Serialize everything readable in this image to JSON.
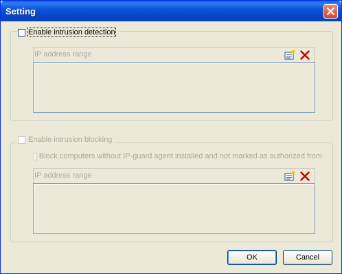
{
  "window": {
    "title": "Setting"
  },
  "detection": {
    "checkbox_label": "Enable intrusion detection",
    "checked": false,
    "list_header": "IP address range"
  },
  "blocking": {
    "checkbox_label": "Enable intrusion blocking",
    "checked": false,
    "sub_checkbox_label": "Block computers without IP-guard agent installed and not marked as authorized from",
    "list_header": "IP address range"
  },
  "buttons": {
    "ok": "OK",
    "cancel": "Cancel"
  },
  "icons": {
    "close": "close-icon",
    "add": "add-range-icon",
    "delete": "delete-icon"
  },
  "colors": {
    "title_bar": "#0a5fe3",
    "delete_red": "#c00000",
    "dialog_bg": "#ece9d8"
  }
}
